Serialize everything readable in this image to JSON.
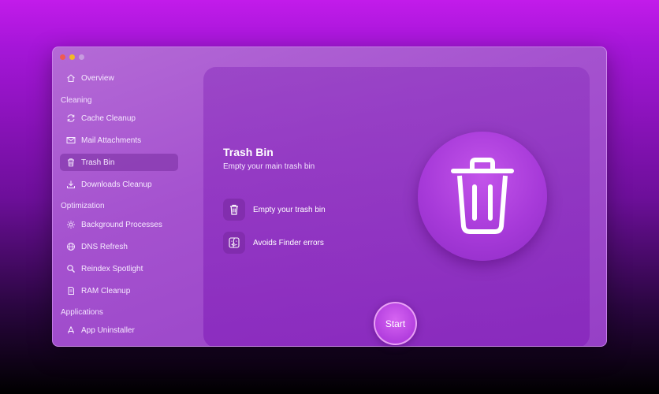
{
  "sidebar": {
    "overview": "Overview",
    "sections": [
      {
        "heading": "Cleaning",
        "items": [
          "Cache Cleanup",
          "Mail Attachments",
          "Trash Bin",
          "Downloads Cleanup"
        ]
      },
      {
        "heading": "Optimization",
        "items": [
          "Background Processes",
          "DNS Refresh",
          "Reindex Spotlight",
          "RAM Cleanup"
        ]
      },
      {
        "heading": "Applications",
        "items": [
          "App Uninstaller"
        ]
      }
    ],
    "active_item": "Trash Bin"
  },
  "main": {
    "title": "Trash Bin",
    "subtitle": "Empty your main trash bin",
    "features": [
      "Empty your trash bin",
      "Avoids Finder errors"
    ],
    "start_label": "Start"
  },
  "icons": {
    "overview": "house-icon",
    "cache_cleanup": "refresh-icon",
    "mail_attachments": "envelope-icon",
    "trash_bin": "trash-icon",
    "downloads_cleanup": "download-icon",
    "background_processes": "gear-icon",
    "dns_refresh": "globe-icon",
    "reindex_spotlight": "magnifier-icon",
    "ram_cleanup": "memory-icon",
    "app_uninstaller": "app-store-icon",
    "feature_trash": "trash-icon",
    "feature_finder": "finder-icon",
    "hero": "trash-icon"
  },
  "colors": {
    "background_top": "#c21bea",
    "background_bottom": "#000000",
    "window": "#a552cf",
    "active_item": "#7a2da0",
    "start_button": "#b23ede",
    "traffic_red": "#ef5b52",
    "traffic_yellow": "#f2b829"
  }
}
